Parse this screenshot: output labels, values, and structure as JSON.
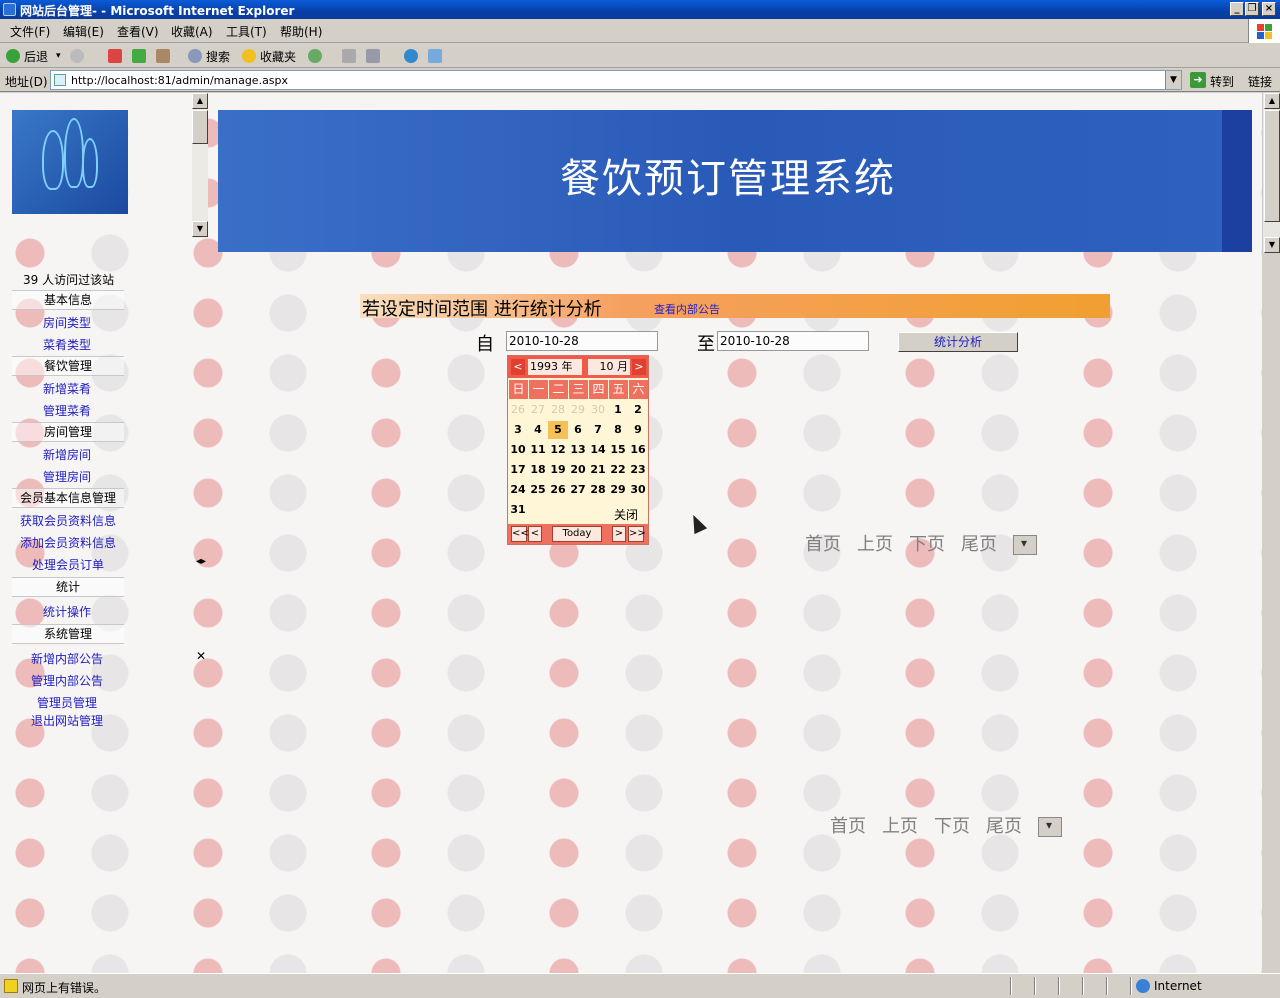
{
  "window": {
    "title": "网站后台管理- - Microsoft Internet Explorer"
  },
  "menu": [
    "文件(F)",
    "编辑(E)",
    "查看(V)",
    "收藏(A)",
    "工具(T)",
    "帮助(H)"
  ],
  "toolbar": {
    "back": "后退",
    "search": "搜索",
    "favorites": "收藏夹"
  },
  "address": {
    "label": "地址(D)",
    "url": "http://localhost:81/admin/manage.aspx",
    "go": "转到",
    "links": "链接"
  },
  "banner": {
    "title": "餐饮预订管理系统"
  },
  "sidebar": {
    "visit": "39 人访问过该站",
    "basic_info": "基本信息",
    "room_type": "房间类型",
    "dish_type": "菜肴类型",
    "catering_mgmt": "餐饮管理",
    "add_dish": "新增菜肴",
    "manage_dish": "管理菜肴",
    "room_mgmt": "房间管理",
    "add_room": "新增房间",
    "manage_room": "管理房间",
    "member_mgmt": "会员基本信息管理",
    "get_member": "获取会员资料信息",
    "add_member": "添加会员资料信息",
    "handle_orders": "处理会员订单",
    "stats": "统计",
    "stats_op": "统计操作",
    "sys_mgmt": "系统管理",
    "add_notice": "新增内部公告",
    "manage_notice": "管理内部公告",
    "admin_mgmt": "管理员管理",
    "logout": "退出网站管理"
  },
  "main": {
    "stat_title": "若设定时间范围 进行统计分析",
    "view_notice": "查看内部公告",
    "from_label": "自",
    "to_label": "至",
    "from_date": "2010-10-28",
    "to_date": "2010-10-28",
    "analyze_button": "统计分析"
  },
  "calendar": {
    "year": "1993",
    "year_suffix": "年",
    "month": "10",
    "month_suffix": "月",
    "weekdays": [
      "日",
      "一",
      "二",
      "三",
      "四",
      "五",
      "六"
    ],
    "close": "关闭",
    "today": "Today",
    "nav_prev_year": "<<",
    "nav_prev": "<",
    "nav_next": ">",
    "nav_next_year": ">>",
    "selected_day": "5"
  },
  "pager": {
    "first": "首页",
    "prev": "上页",
    "next": "下页",
    "last": "尾页"
  },
  "status": {
    "message": "网页上有错误。",
    "zone": "Internet"
  }
}
